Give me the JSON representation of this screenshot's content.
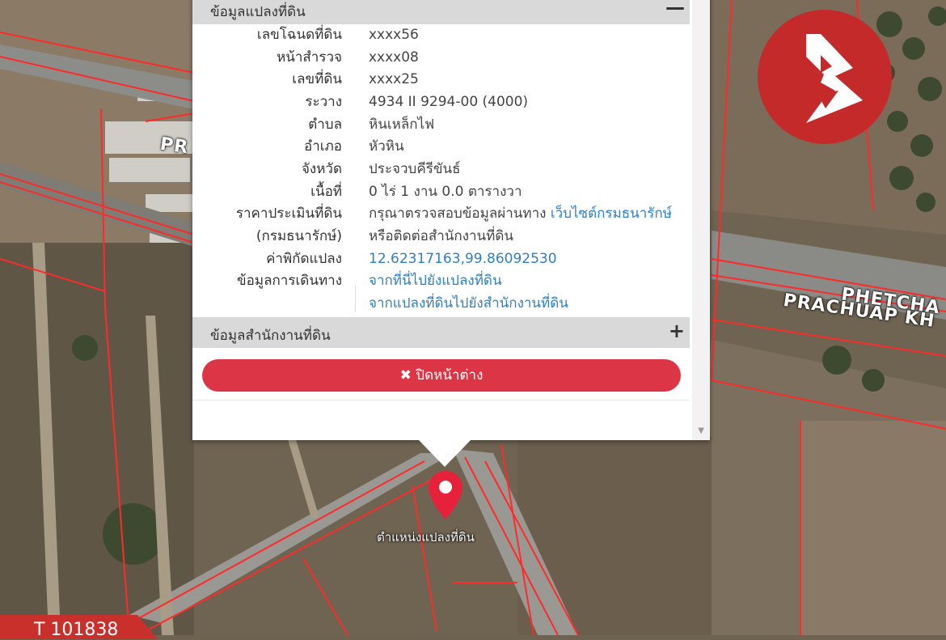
{
  "map": {
    "road_label_left": "PR",
    "road_label_right_1": "PHETCHA",
    "road_label_right_2": "PRACHUAP KH",
    "pin_label": "ตำแหน่งแปลงที่ดิน",
    "pin_icon": "map-marker-icon",
    "property_id": "T 101838",
    "brand_color": "#c52a2a",
    "boundary_color": "#ff2a2a"
  },
  "popup": {
    "section1_title": "ข้อมูลแปลงที่ดิน",
    "section1_icon": "minus-icon",
    "rows": [
      {
        "label": "เลขโฉนดที่ดิน",
        "value": "xxxx56"
      },
      {
        "label": "หน้าสำรวจ",
        "value": "xxxx08"
      },
      {
        "label": "เลขที่ดิน",
        "value": "xxxx25"
      },
      {
        "label": "ระวาง",
        "value": "4934 II 9294-00 (4000)"
      },
      {
        "label": "ตำบล",
        "value": "หินเหล็กไฟ"
      },
      {
        "label": "อำเภอ",
        "value": "หัวหิน"
      },
      {
        "label": "จังหวัด",
        "value": "ประจวบคีรีขันธ์"
      },
      {
        "label": "เนื้อที่",
        "value": "0 ไร่ 1 งาน 0.0 ตารางวา"
      }
    ],
    "price_label_1": "ราคาประเมินที่ดิน",
    "price_label_2": "(กรมธนารักษ์)",
    "price_text_1": "กรุณาตรวจสอบข้อมูลผ่านทาง",
    "price_link": "เว็บไซต์กรมธนารักษ์",
    "price_text_2": "หรือติดต่อสำนักงานที่ดิน",
    "coord_label": "ค่าพิกัดแปลง",
    "coord_value": "12.62317163,99.86092530",
    "travel_label": "ข้อมูลการเดินทาง",
    "travel_link_1": "จากที่นี่ไปยังแปลงที่ดิน",
    "travel_link_2": "จากแปลงที่ดินไปยังสำนักงานที่ดิน",
    "section2_title": "ข้อมูลสำนักงานที่ดิน",
    "section2_icon": "plus-icon",
    "close_icon": "close-icon",
    "close_label": "ปิดหน้าต่าง",
    "close_color": "#dc3545",
    "link_color": "#2f7fc4"
  }
}
